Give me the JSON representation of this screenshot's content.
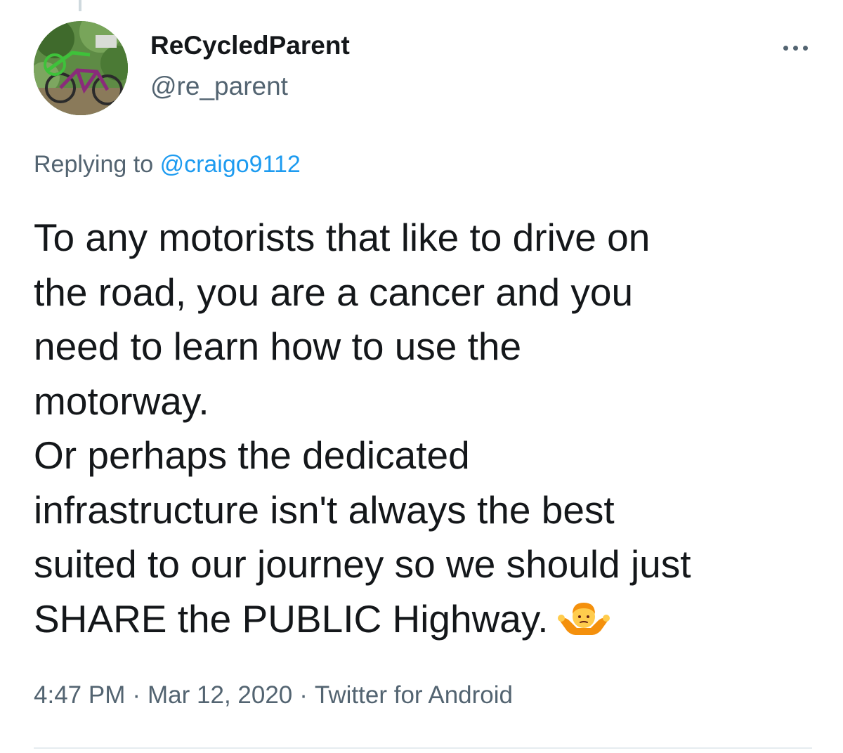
{
  "tweet": {
    "display_name": "ReCycledParent",
    "handle": "@re_parent",
    "more_icon": "ellipsis-icon",
    "reply": {
      "prefix": "Replying to",
      "mention": "@craigo9112"
    },
    "lines": [
      "To any motorists that like to drive on",
      "the road, you are a cancer and you",
      "need to learn how to use the",
      "motorway.",
      "Or perhaps the dedicated",
      "infrastructure isn't always the best",
      "suited to our journey so we should just",
      "SHARE the PUBLIC Highway."
    ],
    "emoji": "person-shrugging-icon",
    "time": "4:47 PM",
    "separator": "·",
    "date": "Mar 12, 2020",
    "source": "Twitter for Android"
  },
  "colors": {
    "text_primary": "#14171a",
    "text_secondary": "#536471",
    "link": "#1d9bf0",
    "divider": "#e6ecf0"
  }
}
